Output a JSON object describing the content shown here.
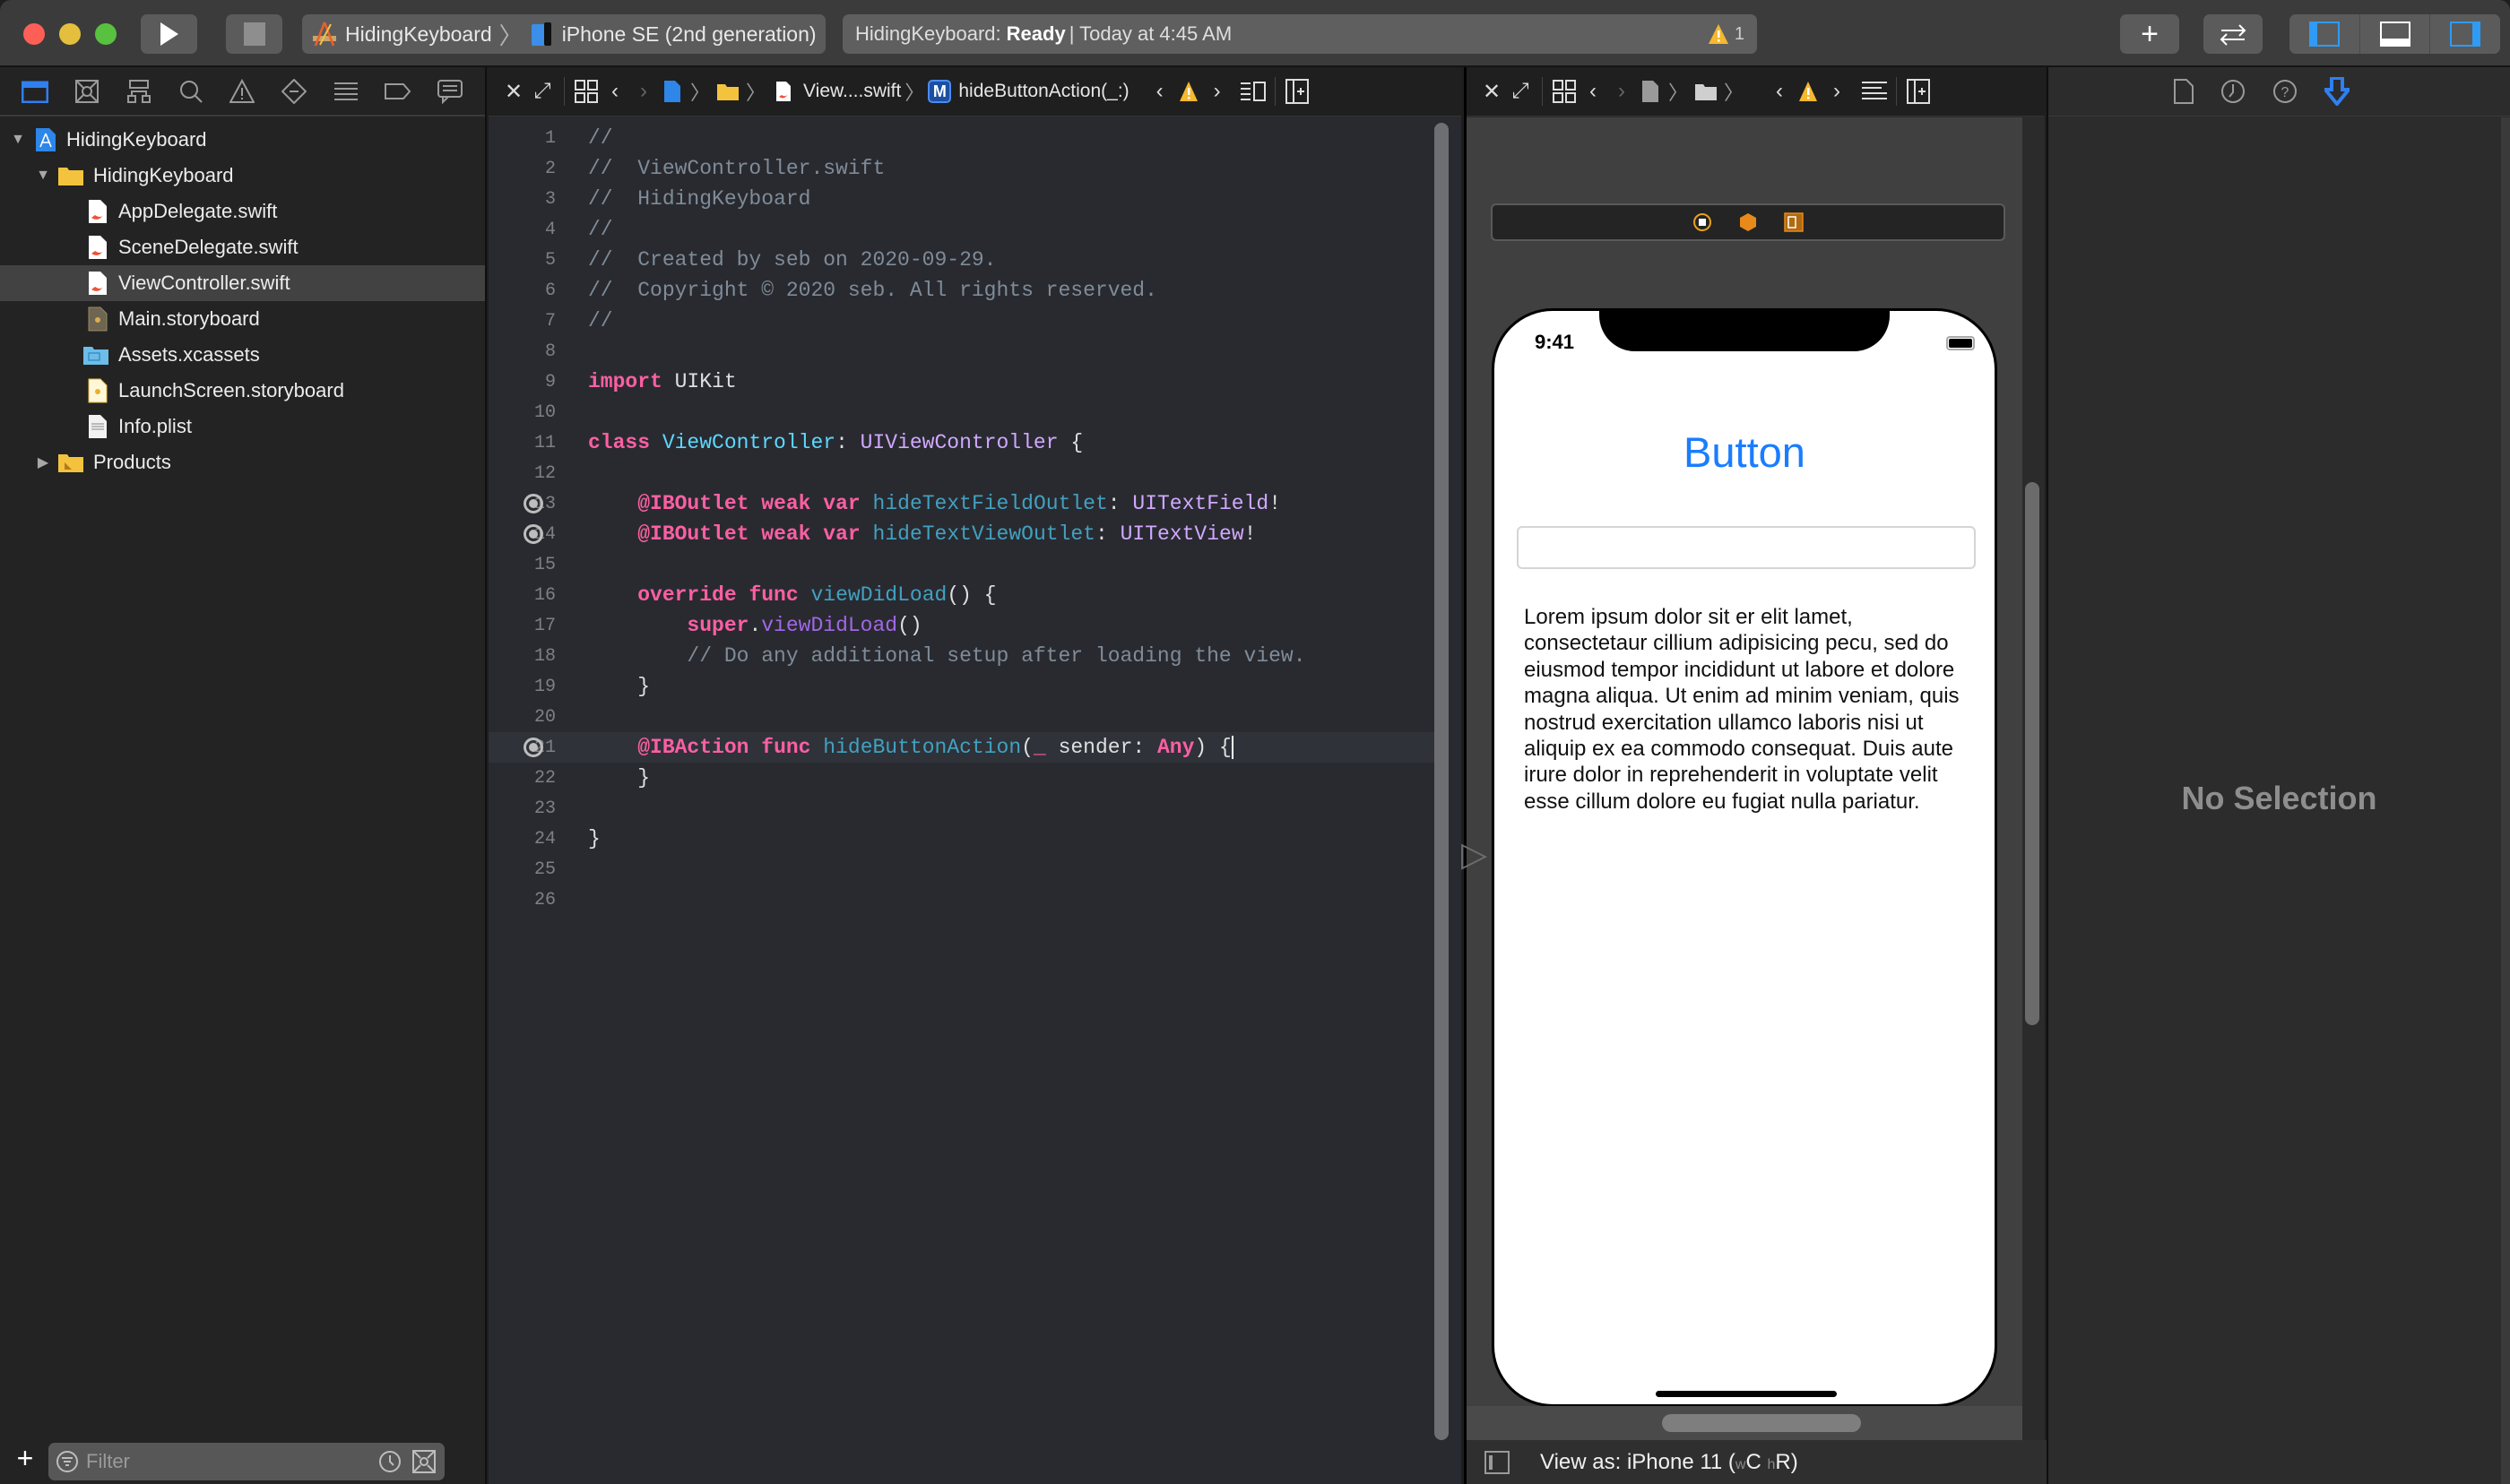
{
  "toolbar": {
    "scheme_project": "HidingKeyboard",
    "scheme_device": "iPhone SE (2nd generation)",
    "activity_project": "HidingKeyboard:",
    "activity_status": "Ready",
    "activity_time": "| Today at 4:45 AM",
    "warning_count": "1",
    "accent_color": "#2f9bf5"
  },
  "navigator": {
    "tabs": [
      "project-navigator",
      "source-control-navigator",
      "symbol-navigator",
      "find-navigator",
      "issue-navigator",
      "test-navigator",
      "debug-navigator",
      "breakpoint-navigator",
      "report-navigator"
    ],
    "tree": [
      {
        "label": "HidingKeyboard",
        "kind": "project",
        "depth": 0,
        "expanded": true
      },
      {
        "label": "HidingKeyboard",
        "kind": "folder",
        "depth": 1,
        "expanded": true
      },
      {
        "label": "AppDelegate.swift",
        "kind": "swift",
        "depth": 2
      },
      {
        "label": "SceneDelegate.swift",
        "kind": "swift",
        "depth": 2
      },
      {
        "label": "ViewController.swift",
        "kind": "swift",
        "depth": 2,
        "selected": true
      },
      {
        "label": "Main.storyboard",
        "kind": "storyboard",
        "depth": 2
      },
      {
        "label": "Assets.xcassets",
        "kind": "assets",
        "depth": 2
      },
      {
        "label": "LaunchScreen.storyboard",
        "kind": "storyboard-launch",
        "depth": 2
      },
      {
        "label": "Info.plist",
        "kind": "plist",
        "depth": 2
      },
      {
        "label": "Products",
        "kind": "folder",
        "depth": 1,
        "expanded": false
      }
    ],
    "filter_placeholder": "Filter"
  },
  "editor": {
    "jumpbar": {
      "file": "View....swift",
      "symbol_badge": "M",
      "symbol": "hideButtonAction(_:)"
    },
    "current_line": 21,
    "lines": [
      {
        "n": "1",
        "tokens": [
          [
            "c",
            "//"
          ]
        ]
      },
      {
        "n": "2",
        "tokens": [
          [
            "c",
            "//  ViewController.swift"
          ]
        ]
      },
      {
        "n": "3",
        "tokens": [
          [
            "c",
            "//  HidingKeyboard"
          ]
        ]
      },
      {
        "n": "4",
        "tokens": [
          [
            "c",
            "//"
          ]
        ]
      },
      {
        "n": "5",
        "tokens": [
          [
            "c",
            "//  Created by seb on 2020-09-29."
          ]
        ]
      },
      {
        "n": "6",
        "tokens": [
          [
            "c",
            "//  Copyright © 2020 seb. All rights reserved."
          ]
        ]
      },
      {
        "n": "7",
        "tokens": [
          [
            "c",
            "//"
          ]
        ]
      },
      {
        "n": "8",
        "tokens": []
      },
      {
        "n": "9",
        "tokens": [
          [
            "k",
            "import"
          ],
          [
            "p",
            " UIKit"
          ]
        ]
      },
      {
        "n": "10",
        "tokens": []
      },
      {
        "n": "11",
        "tokens": [
          [
            "k",
            "class"
          ],
          [
            "p",
            " "
          ],
          [
            "d",
            "ViewController"
          ],
          [
            "p",
            ": "
          ],
          [
            "t",
            "UIViewController"
          ],
          [
            "p",
            " {"
          ]
        ]
      },
      {
        "n": "12",
        "tokens": []
      },
      {
        "n": "13",
        "outlet": true,
        "tokens": [
          [
            "p",
            "    "
          ],
          [
            "k",
            "@IBOutlet"
          ],
          [
            "p",
            " "
          ],
          [
            "k",
            "weak"
          ],
          [
            "p",
            " "
          ],
          [
            "k",
            "var"
          ],
          [
            "p",
            " "
          ],
          [
            "f",
            "hideTextFieldOutlet"
          ],
          [
            "p",
            ": "
          ],
          [
            "t",
            "UITextField"
          ],
          [
            "p",
            "!"
          ]
        ]
      },
      {
        "n": "14",
        "outlet": true,
        "tokens": [
          [
            "p",
            "    "
          ],
          [
            "k",
            "@IBOutlet"
          ],
          [
            "p",
            " "
          ],
          [
            "k",
            "weak"
          ],
          [
            "p",
            " "
          ],
          [
            "k",
            "var"
          ],
          [
            "p",
            " "
          ],
          [
            "f",
            "hideTextViewOutlet"
          ],
          [
            "p",
            ": "
          ],
          [
            "t",
            "UITextView"
          ],
          [
            "p",
            "!"
          ]
        ]
      },
      {
        "n": "15",
        "tokens": []
      },
      {
        "n": "16",
        "tokens": [
          [
            "p",
            "    "
          ],
          [
            "k",
            "override"
          ],
          [
            "p",
            " "
          ],
          [
            "k",
            "func"
          ],
          [
            "p",
            " "
          ],
          [
            "f",
            "viewDidLoad"
          ],
          [
            "p",
            "() {"
          ]
        ]
      },
      {
        "n": "17",
        "tokens": [
          [
            "p",
            "        "
          ],
          [
            "k",
            "super"
          ],
          [
            "p",
            "."
          ],
          [
            "m",
            "viewDidLoad"
          ],
          [
            "p",
            "()"
          ]
        ]
      },
      {
        "n": "18",
        "tokens": [
          [
            "p",
            "        "
          ],
          [
            "c",
            "// Do any additional setup after loading the view."
          ]
        ]
      },
      {
        "n": "19",
        "tokens": [
          [
            "p",
            "    }"
          ]
        ]
      },
      {
        "n": "20",
        "tokens": []
      },
      {
        "n": "21",
        "outlet": true,
        "cursor": true,
        "tokens": [
          [
            "p",
            "    "
          ],
          [
            "k",
            "@IBAction"
          ],
          [
            "p",
            " "
          ],
          [
            "k",
            "func"
          ],
          [
            "p",
            " "
          ],
          [
            "f",
            "hideButtonAction"
          ],
          [
            "p",
            "("
          ],
          [
            "k",
            "_"
          ],
          [
            "p",
            " sender: "
          ],
          [
            "k",
            "Any"
          ],
          [
            "p",
            ") {"
          ]
        ]
      },
      {
        "n": "22",
        "tokens": [
          [
            "p",
            "    }"
          ]
        ]
      },
      {
        "n": "23",
        "tokens": []
      },
      {
        "n": "24",
        "tokens": [
          [
            "p",
            "}"
          ]
        ]
      },
      {
        "n": "25",
        "tokens": []
      },
      {
        "n": "26",
        "tokens": []
      }
    ]
  },
  "canvas": {
    "status_time": "9:41",
    "button_label": "Button",
    "textfield_value": "",
    "textview_text": "Lorem ipsum dolor sit er elit lamet, consectetaur cillium adipisicing pecu, sed do eiusmod tempor incididunt ut labore et dolore magna aliqua. Ut enim ad minim veniam, quis nostrud exercitation ullamco laboris nisi ut aliquip ex ea commodo consequat. Duis aute irure dolor in reprehenderit in voluptate velit esse cillum dolore eu fugiat nulla pariatur.",
    "view_as_prefix": "View as: iPhone 11 (",
    "size_w": "w",
    "size_w_val": "C",
    "size_h": "h",
    "size_h_val": "R",
    "view_as_suffix": ")",
    "button_color": "#1a7dff"
  },
  "inspector": {
    "tabs": [
      "file-inspector",
      "history-inspector",
      "quick-help-inspector",
      "attributes-inspector"
    ],
    "empty_message": "No Selection"
  }
}
